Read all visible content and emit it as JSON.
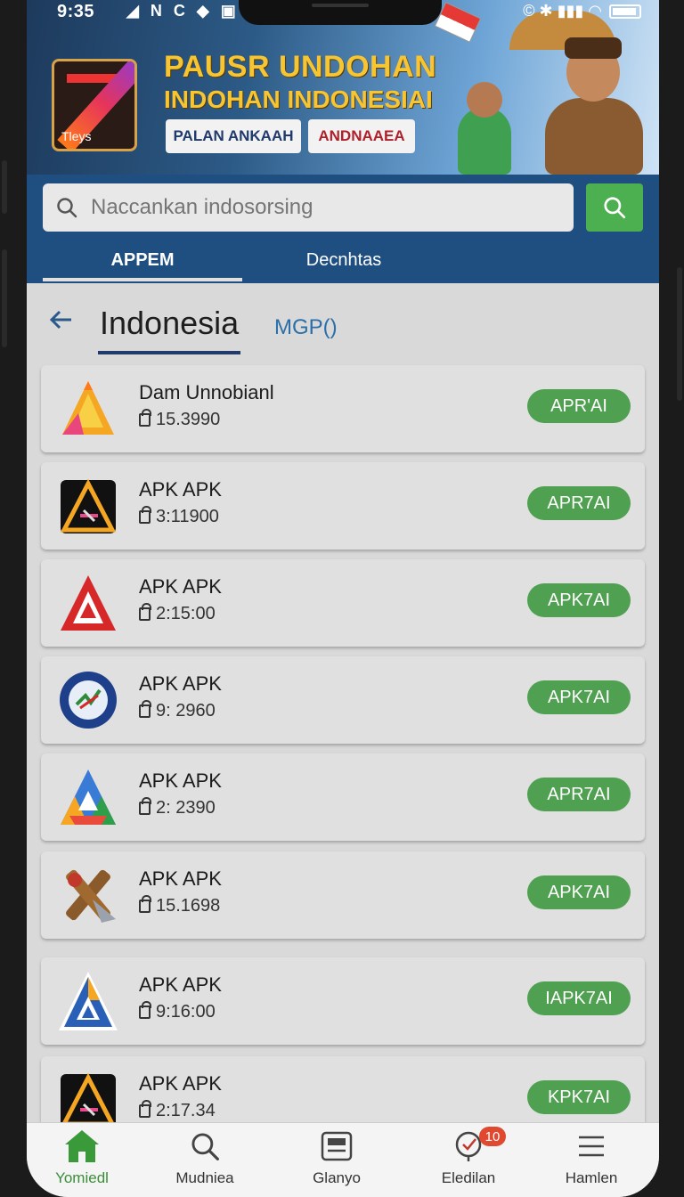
{
  "status_bar": {
    "time": "9:35",
    "left_icons": "◢ N C ◆ ▣",
    "right_icons": "© ✱ ▮▮▮ ◠"
  },
  "banner": {
    "logo_text": "Tleys",
    "title_line1": "PAUSR UNDOHAN",
    "title_line2": "INDOHAN INDONESIAI",
    "button1": "PALAN ANKAAH",
    "button2": "ANDNAAEA"
  },
  "search": {
    "placeholder": "Naccankan indosorsing"
  },
  "tabs": [
    {
      "label": "APPEM"
    },
    {
      "label": "Decnhtas"
    }
  ],
  "heading": {
    "title": "Indonesia",
    "subtitle": "MGP()"
  },
  "apps": [
    {
      "name": "Dam Unnobianl",
      "meta": "15.3990",
      "button": "APR'AI",
      "icon": "orange-a-icon"
    },
    {
      "name": "APK APK",
      "meta": "3:11900",
      "button": "APR7AI",
      "icon": "black-a-triangle-icon"
    },
    {
      "name": "APK APK",
      "meta": "2:15:00",
      "button": "APK7AI",
      "icon": "red-apk-a-icon"
    },
    {
      "name": "APK APK",
      "meta": "9: 2960",
      "button": "APK7AI",
      "icon": "blue-seal-icon"
    },
    {
      "name": "APK APK",
      "meta": "2: 2390",
      "button": "APR7AI",
      "icon": "multicolor-a-icon"
    },
    {
      "name": "APK APK",
      "meta": "15.1698",
      "button": "APK7AI",
      "icon": "tools-icon"
    },
    {
      "name": "APK APK",
      "meta": "9:16:00",
      "button": "IAPK7AI",
      "icon": "blue-apk-a-icon"
    },
    {
      "name": "APK APK",
      "meta": "2:17.34",
      "button": "KPK7AI",
      "icon": "black-a-triangle-icon"
    }
  ],
  "bottom_nav": [
    {
      "label": "Yomiedl",
      "icon": "home-icon",
      "active": true
    },
    {
      "label": "Mudniea",
      "icon": "search-icon"
    },
    {
      "label": "Glanyo",
      "icon": "card-icon"
    },
    {
      "label": "Eledilan",
      "icon": "heart-icon",
      "badge": "10"
    },
    {
      "label": "Hamlen",
      "icon": "menu-icon"
    }
  ],
  "colors": {
    "accent_green": "#4fa050",
    "header_blue": "#1f4f80",
    "banner_gold": "#f7c531"
  }
}
